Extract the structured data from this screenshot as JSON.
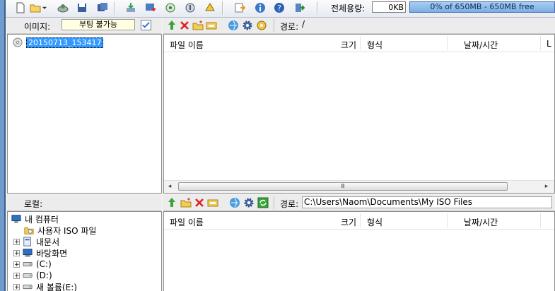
{
  "toolbar": {
    "buttons": [
      "new-icon",
      "open-icon",
      "dropdown-icon",
      "burn-icon",
      "save-icon",
      "save-as-icon",
      "extract-icon",
      "add-files-icon",
      "mount-icon",
      "properties-icon",
      "compress-icon",
      "options-icon",
      "info-icon",
      "help-icon",
      "exit-icon"
    ],
    "capacity_label": "전체용량:",
    "used": "0KB",
    "capacity_text": "0% of 650MB - 650MB free",
    "capacity_percent": 0
  },
  "image_panel": {
    "label": "이미지:",
    "status": "부팅 불가능",
    "root_item": "20150713_153417",
    "path_label": "경로:",
    "path": "/",
    "columns": [
      "파일 이름",
      "크기",
      "형식",
      "날짜/시간",
      "L"
    ]
  },
  "local_panel": {
    "label": "로컬:",
    "path_label": "경로:",
    "path": "C:\\Users\\Naom\\Documents\\My ISO Files",
    "columns": [
      "파일 이름",
      "크기",
      "형식",
      "날짜/시간",
      ""
    ],
    "tree": [
      {
        "label": "내 컴퓨터"
      },
      {
        "label": "사용자 ISO 파일"
      },
      {
        "label": "내문서"
      },
      {
        "label": "바탕화면"
      },
      {
        "label": "(C:)"
      },
      {
        "label": "(D:)"
      },
      {
        "label": "새 볼륨(E:)"
      }
    ]
  },
  "scrollbar": {
    "grip": "Ⅲ",
    "left_arrow": "◂",
    "right_arrow": "▸"
  },
  "colors": {
    "accent": "#6f9ccd",
    "selection": "#3399ff",
    "status_bg": "#ffffe1",
    "capacity_bar": "#8fbfee"
  }
}
